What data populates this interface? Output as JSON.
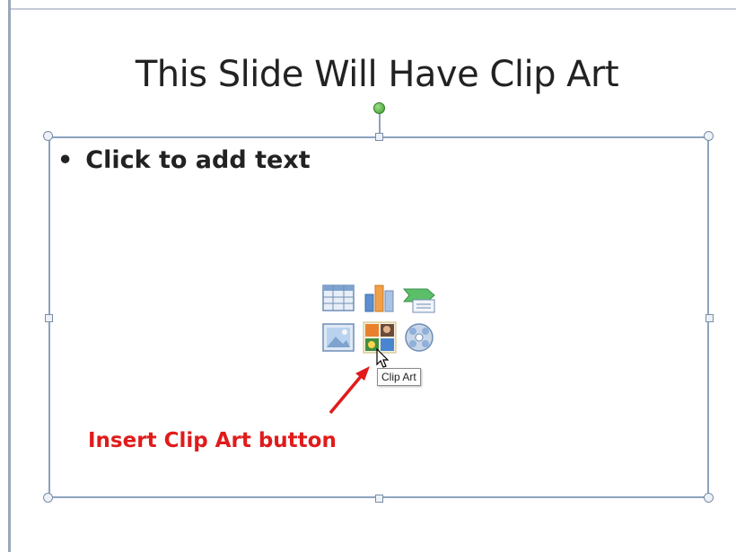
{
  "slide": {
    "title": "This Slide Will Have Clip Art",
    "bullet_text": "Click to add text",
    "bullet_marker": "•"
  },
  "content_icons": [
    {
      "name": "insert-table-icon"
    },
    {
      "name": "insert-chart-icon"
    },
    {
      "name": "insert-smartart-icon"
    },
    {
      "name": "insert-picture-icon"
    },
    {
      "name": "insert-clip-art-icon"
    },
    {
      "name": "insert-media-icon"
    }
  ],
  "tooltip": {
    "text": "Clip Art"
  },
  "annotation": {
    "label": "Insert Clip Art button",
    "color": "#e01b1b"
  },
  "colors": {
    "placeholder_border": "#8da3bf",
    "rotate_handle": "#3a9a2a"
  }
}
